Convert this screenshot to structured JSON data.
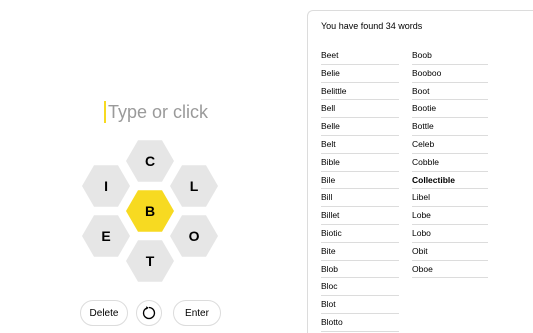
{
  "input": {
    "placeholder": "Type or click"
  },
  "hive": {
    "center_letter": "B",
    "outer_letters": {
      "top": "C",
      "upper_left": "I",
      "upper_right": "L",
      "lower_left": "E",
      "lower_right": "O",
      "bottom": "T"
    },
    "colors": {
      "center": "#f7da21",
      "outer": "#e6e6e6"
    }
  },
  "controls": {
    "delete_label": "Delete",
    "shuffle_icon": "shuffle-icon",
    "enter_label": "Enter"
  },
  "found": {
    "title": "You have found 34 words",
    "column1": [
      "Beet",
      "Belie",
      "Belittle",
      "Bell",
      "Belle",
      "Belt",
      "Bible",
      "Bile",
      "Bill",
      "Billet",
      "Biotic",
      "Bite",
      "Blob",
      "Bloc",
      "Blot",
      "Blotto"
    ],
    "column2": [
      "Boob",
      "Booboo",
      "Boot",
      "Bootie",
      "Bottle",
      "Celeb",
      "Cobble",
      "Collectible",
      "Libel",
      "Lobe",
      "Lobo",
      "Obit",
      "Oboe"
    ],
    "pangram": "Collectible"
  }
}
